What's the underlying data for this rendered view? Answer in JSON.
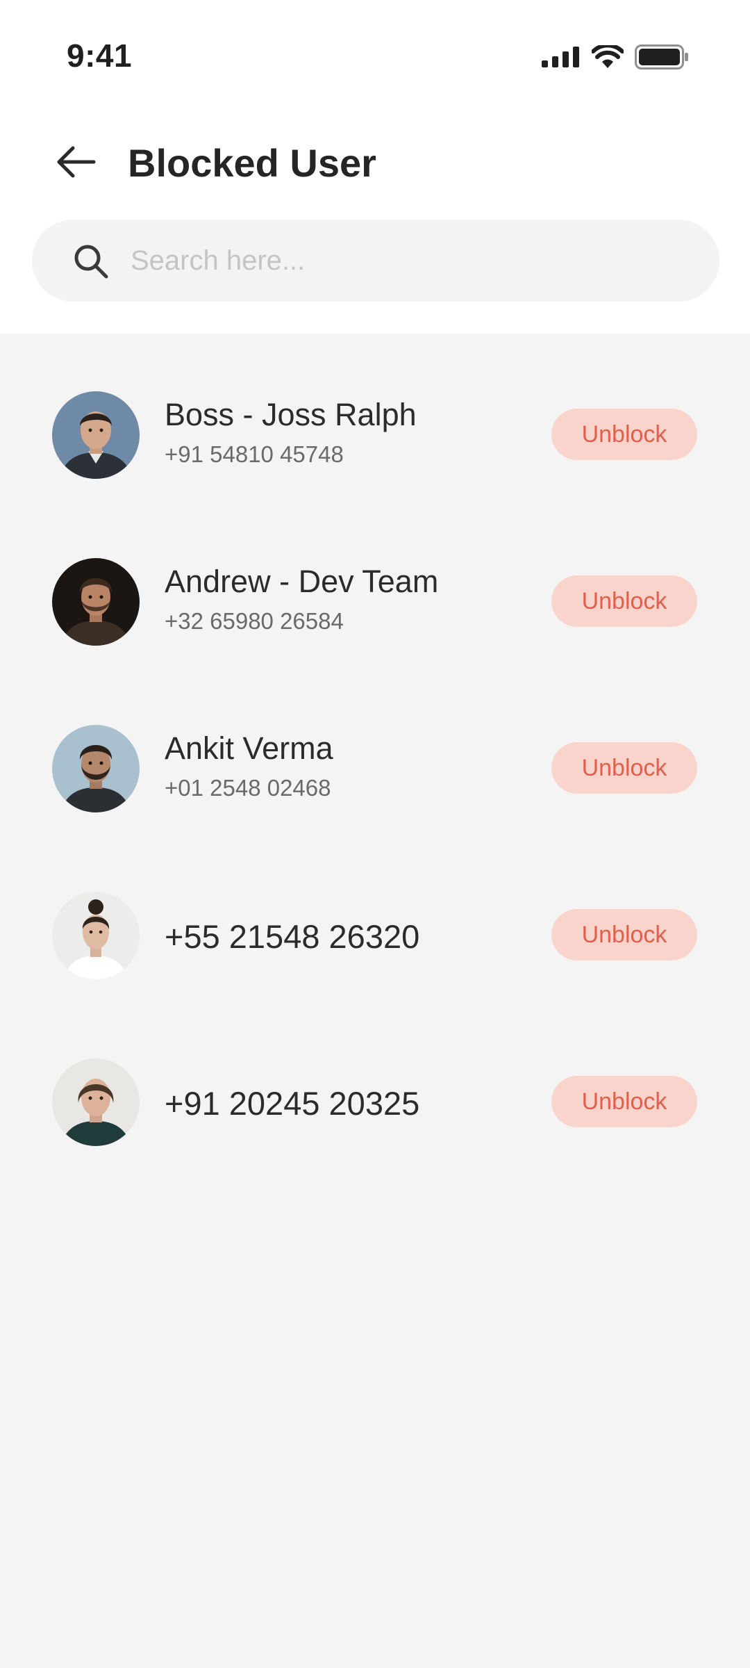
{
  "status_bar": {
    "time": "9:41",
    "icons": [
      "signal-icon",
      "wifi-icon",
      "battery-icon"
    ]
  },
  "header": {
    "back_icon": "arrow-left-icon",
    "title": "Blocked User"
  },
  "search": {
    "icon": "search-icon",
    "placeholder": "Search here...",
    "value": ""
  },
  "blocked_users": [
    {
      "name": "Boss - Joss Ralph",
      "phone": "+91 54810 45748",
      "action": "Unblock"
    },
    {
      "name": "Andrew - Dev Team",
      "phone": "+32 65980 26584",
      "action": "Unblock"
    },
    {
      "name": "Ankit Verma",
      "phone": "+01 2548 02468",
      "action": "Unblock"
    },
    {
      "name": "+55 21548 26320",
      "phone": "",
      "action": "Unblock"
    },
    {
      "name": "+91 20245 20325",
      "phone": "",
      "action": "Unblock"
    }
  ],
  "colors": {
    "background": "#f4f4f4",
    "header_background": "#ffffff",
    "search_background": "#f3f3f3",
    "unblock_background": "#f9d4cd",
    "unblock_text": "#e0604a",
    "title_text": "#252525"
  }
}
